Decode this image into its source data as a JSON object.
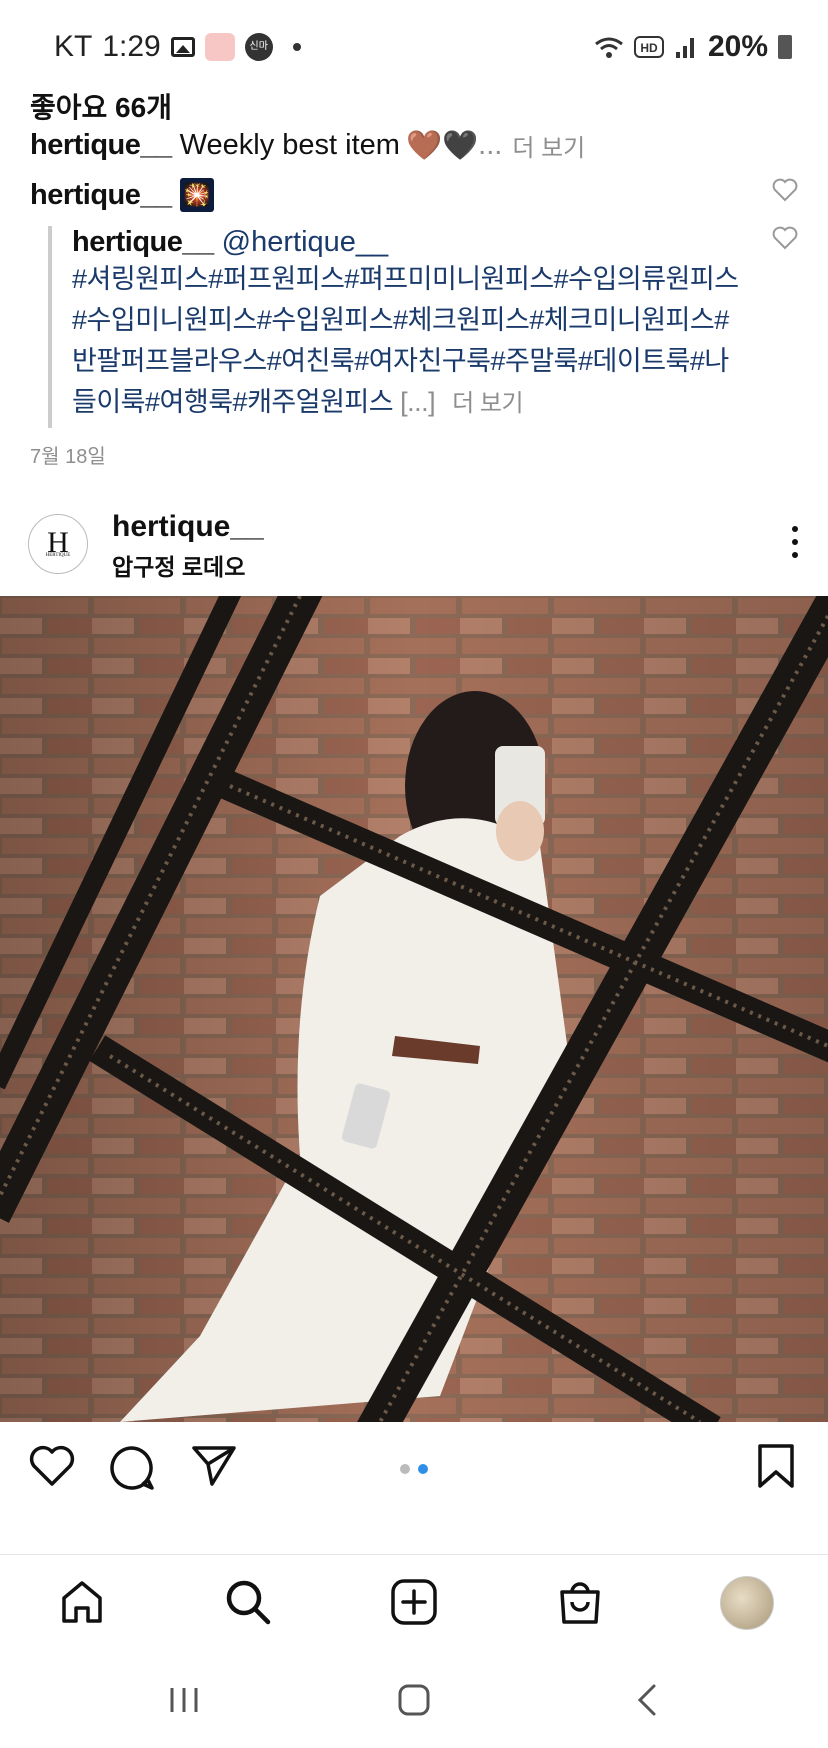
{
  "status_bar": {
    "carrier": "KT",
    "time": "1:29",
    "badge_text": "신마",
    "battery": "20%",
    "icons": [
      "image-icon",
      "cat-sticker-icon",
      "badge-icon",
      "dot-icon",
      "wifi-icon",
      "hd-icon",
      "signal-icon",
      "battery-icon"
    ]
  },
  "post_top": {
    "likes": "좋아요 66개",
    "caption_user": "hertique__",
    "caption_text": "Weekly best item",
    "caption_emoji": "🤎🖤",
    "caption_ellipsis": "...",
    "more_label": "더 보기",
    "comment_user": "hertique__",
    "comment_emoji": "🎇",
    "reply_user": "hertique__",
    "reply_mention": "@hertique__",
    "reply_hashtags": "#셔링원피스#퍼프원피스#펴프미미니원피스#수입의류원피스#수입미니원피스#수입원피스#체크원피스#체크미니원피스#반팔퍼프블라우스#여친룩#여자친구룩#주말룩#데이트룩#나들이룩#여행룩#캐주얼원피스",
    "reply_ellipsis": "[...]",
    "reply_more_label": "더 보기",
    "date": "7월 18일"
  },
  "post": {
    "avatar_letter": "H",
    "avatar_sub": "HERTIQUE",
    "username": "hertique__",
    "location": "압구정 로데오",
    "photo_description": "mirror-selfie-white-dress",
    "page_index": 2,
    "page_count": 2
  },
  "actions": {
    "icons": [
      "heart-icon",
      "comment-icon",
      "share-icon",
      "bookmark-icon"
    ]
  },
  "bottom_nav": {
    "items": [
      "home-icon",
      "search-icon",
      "create-icon",
      "shop-icon",
      "profile-avatar"
    ]
  },
  "system_nav": {
    "items": [
      "recent-apps-icon",
      "home-button-icon",
      "back-icon"
    ]
  },
  "colors": {
    "accent": "#2f8fe8",
    "hashtag": "#1a3a6b",
    "muted": "#8e8e8e"
  }
}
